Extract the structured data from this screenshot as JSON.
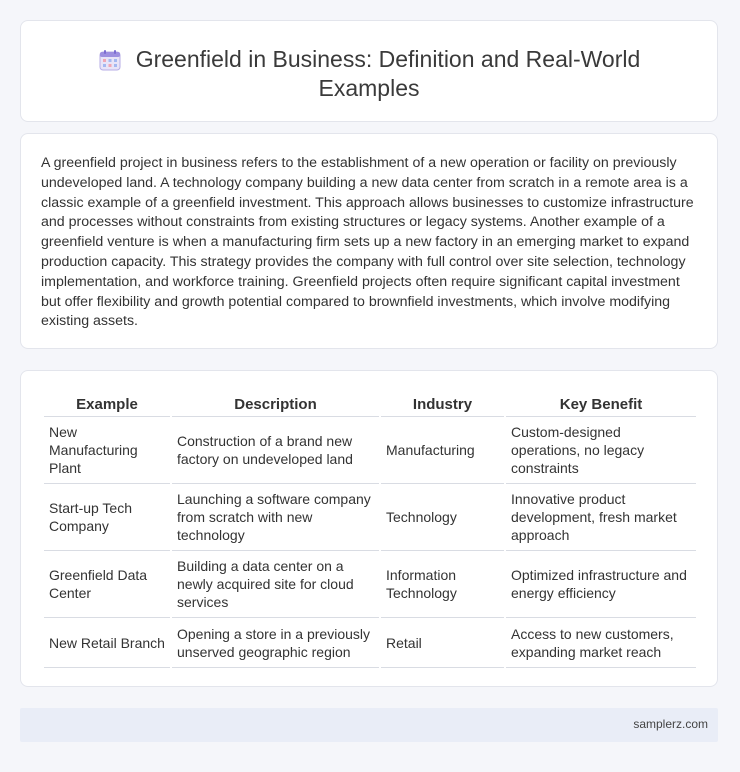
{
  "header": {
    "icon": "calendar-icon",
    "title_line1": "Greenfield in Business: Definition and Real-World",
    "title_line2": "Examples"
  },
  "intro": {
    "paragraph": "A greenfield project in business refers to the establishment of a new operation or facility on previously undeveloped land. A technology company building a new data center from scratch in a remote area is a classic example of a greenfield investment. This approach allows businesses to customize infrastructure and processes without constraints from existing structures or legacy systems. Another example of a greenfield venture is when a manufacturing firm sets up a new factory in an emerging market to expand production capacity. This strategy provides the company with full control over site selection, technology implementation, and workforce training. Greenfield projects often require significant capital investment but offer flexibility and growth potential compared to brownfield investments, which involve modifying existing assets."
  },
  "table": {
    "headers": [
      "Example",
      "Description",
      "Industry",
      "Key Benefit"
    ],
    "rows": [
      [
        "New Manufacturing Plant",
        "Construction of a brand new factory on undeveloped land",
        "Manufacturing",
        "Custom-designed operations, no legacy constraints"
      ],
      [
        "Start-up Tech Company",
        "Launching a software company from scratch with new technology",
        "Technology",
        "Innovative product development, fresh market approach"
      ],
      [
        "Greenfield Data Center",
        "Building a data center on a newly acquired site for cloud services",
        "Information Technology",
        "Optimized infrastructure and energy efficiency"
      ],
      [
        "New Retail Branch",
        "Opening a store in a previously unserved geographic region",
        "Retail",
        "Access to new customers, expanding market reach"
      ]
    ]
  },
  "footer": {
    "site": "samplerz.com"
  }
}
